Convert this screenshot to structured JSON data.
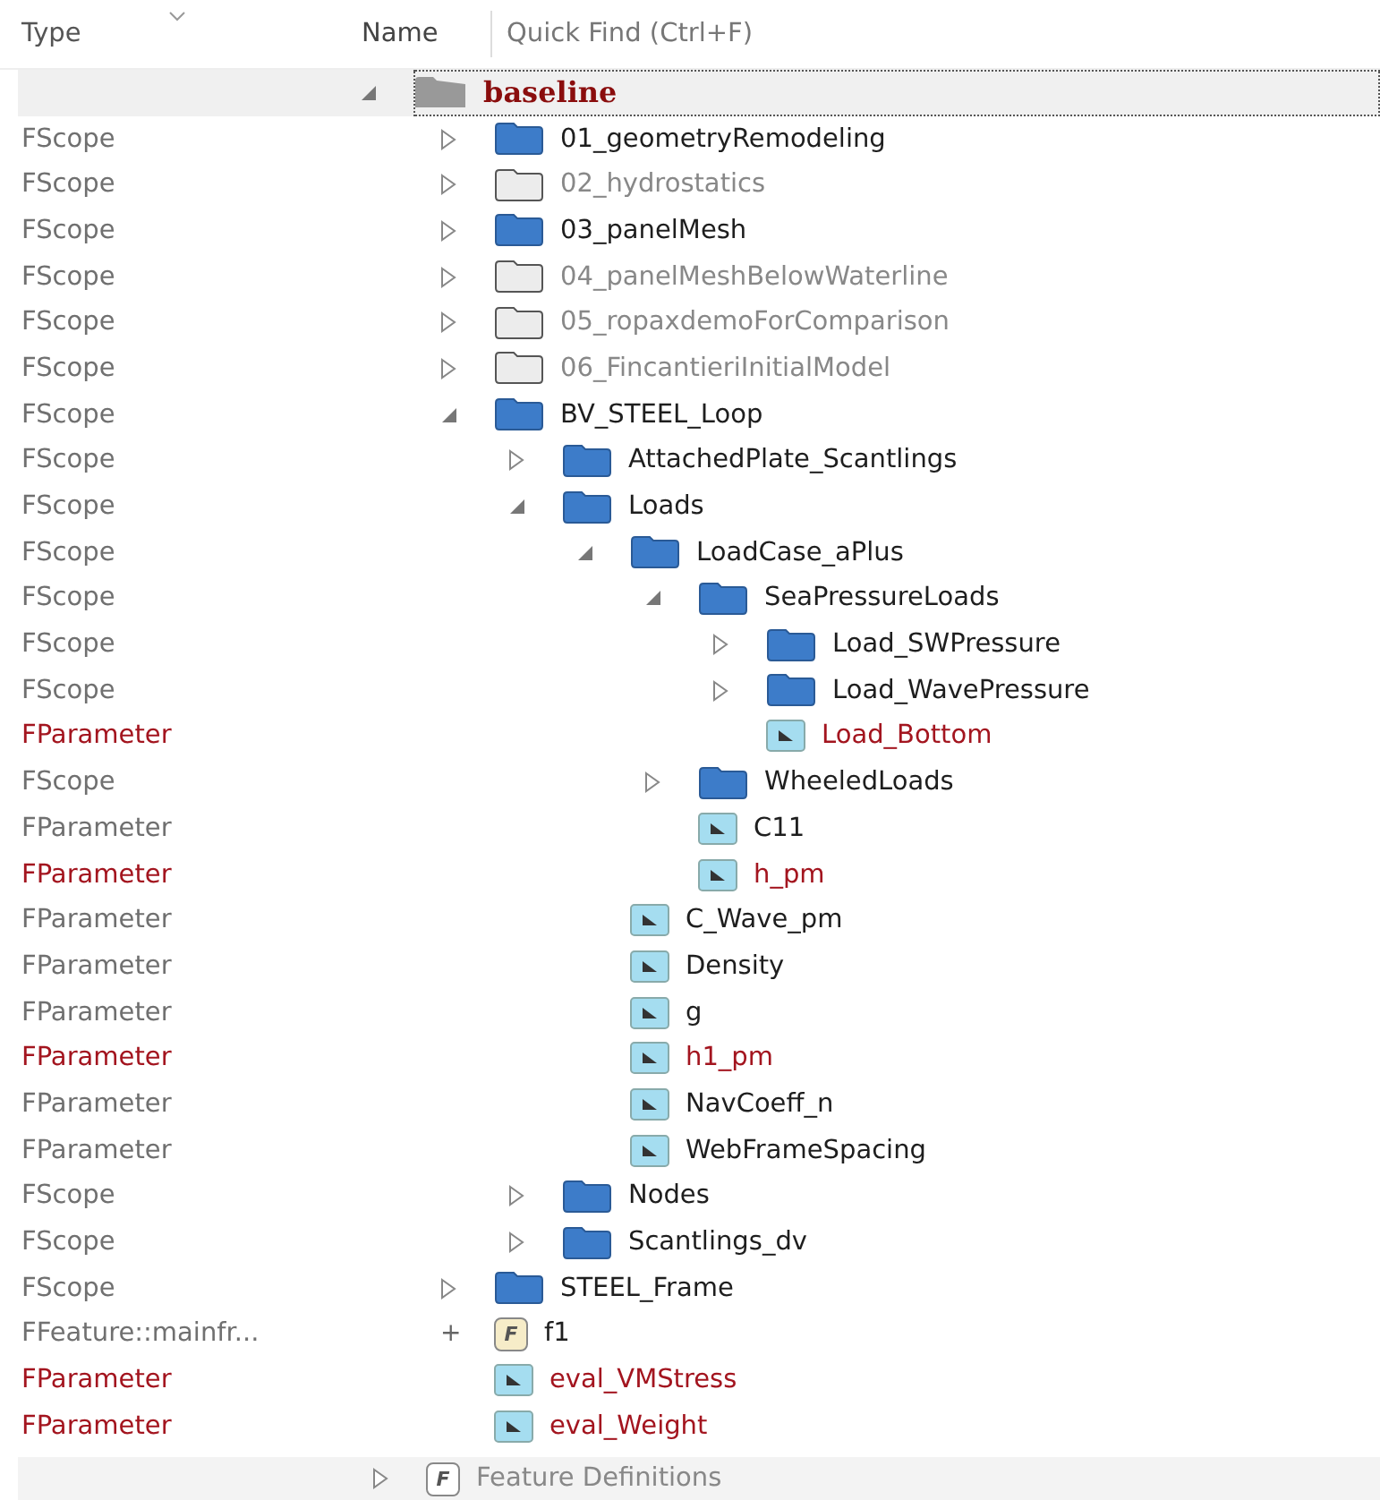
{
  "header": {
    "columns": [
      "Type",
      "Name"
    ],
    "search": {
      "placeholder": "Quick Find (Ctrl+F)"
    }
  },
  "tree": {
    "name": "baseline",
    "kind": "root",
    "selected": true,
    "expanded": true,
    "children": [
      {
        "type": "FScope",
        "name": "01_geometryRemodeling",
        "kind": "folder",
        "disabled": false,
        "modified": false,
        "expanded": false
      },
      {
        "type": "FScope",
        "name": "02_hydrostatics",
        "kind": "folder",
        "disabled": true,
        "modified": false,
        "expanded": false
      },
      {
        "type": "FScope",
        "name": "03_panelMesh",
        "kind": "folder",
        "disabled": false,
        "modified": false,
        "expanded": false
      },
      {
        "type": "FScope",
        "name": "04_panelMeshBelowWaterline",
        "kind": "folder",
        "disabled": true,
        "modified": false,
        "expanded": false
      },
      {
        "type": "FScope",
        "name": "05_ropaxdemoForComparison",
        "kind": "folder",
        "disabled": true,
        "modified": false,
        "expanded": false
      },
      {
        "type": "FScope",
        "name": "06_FincantieriInitialModel",
        "kind": "folder",
        "disabled": true,
        "modified": false,
        "expanded": false
      },
      {
        "type": "FScope",
        "name": "BV_STEEL_Loop",
        "kind": "folder",
        "disabled": false,
        "modified": false,
        "expanded": true,
        "children": [
          {
            "type": "FScope",
            "name": "AttachedPlate_Scantlings",
            "kind": "folder",
            "disabled": false,
            "modified": false,
            "expanded": false
          },
          {
            "type": "FScope",
            "name": "Loads",
            "kind": "folder",
            "disabled": false,
            "modified": false,
            "expanded": true,
            "children": [
              {
                "type": "FScope",
                "name": "LoadCase_aPlus",
                "kind": "folder",
                "disabled": false,
                "modified": false,
                "expanded": true,
                "children": [
                  {
                    "type": "FScope",
                    "name": "SeaPressureLoads",
                    "kind": "folder",
                    "disabled": false,
                    "modified": false,
                    "expanded": true,
                    "children": [
                      {
                        "type": "FScope",
                        "name": "Load_SWPressure",
                        "kind": "folder",
                        "disabled": false,
                        "modified": false,
                        "expanded": false
                      },
                      {
                        "type": "FScope",
                        "name": "Load_WavePressure",
                        "kind": "folder",
                        "disabled": false,
                        "modified": false,
                        "expanded": false
                      },
                      {
                        "type": "FParameter",
                        "name": "Load_Bottom",
                        "kind": "parameter",
                        "modified": true
                      }
                    ]
                  },
                  {
                    "type": "FScope",
                    "name": "WheeledLoads",
                    "kind": "folder",
                    "disabled": false,
                    "modified": false,
                    "expanded": false
                  },
                  {
                    "type": "FParameter",
                    "name": "C11",
                    "kind": "parameter",
                    "modified": false
                  },
                  {
                    "type": "FParameter",
                    "name": "h_pm",
                    "kind": "parameter",
                    "modified": true
                  }
                ]
              },
              {
                "type": "FParameter",
                "name": "C_Wave_pm",
                "kind": "parameter",
                "modified": false
              },
              {
                "type": "FParameter",
                "name": "Density",
                "kind": "parameter",
                "modified": false
              },
              {
                "type": "FParameter",
                "name": "g",
                "kind": "parameter",
                "modified": false
              },
              {
                "type": "FParameter",
                "name": "h1_pm",
                "kind": "parameter",
                "modified": true
              },
              {
                "type": "FParameter",
                "name": "NavCoeff_n",
                "kind": "parameter",
                "modified": false
              },
              {
                "type": "FParameter",
                "name": "WebFrameSpacing",
                "kind": "parameter",
                "modified": false
              }
            ]
          },
          {
            "type": "FScope",
            "name": "Nodes",
            "kind": "folder",
            "disabled": false,
            "modified": false,
            "expanded": false
          },
          {
            "type": "FScope",
            "name": "Scantlings_dv",
            "kind": "folder",
            "disabled": false,
            "modified": false,
            "expanded": false
          }
        ]
      },
      {
        "type": "FScope",
        "name": "STEEL_Frame",
        "kind": "folder",
        "disabled": false,
        "modified": false,
        "expanded": false
      },
      {
        "type": "FFeature::mainfr...",
        "name": "f1",
        "kind": "feature",
        "modified": false,
        "marker": "+",
        "icon_letter": "F"
      },
      {
        "type": "FParameter",
        "name": "eval_VMStress",
        "kind": "parameter",
        "modified": true
      },
      {
        "type": "FParameter",
        "name": "eval_Weight",
        "kind": "parameter",
        "modified": true
      }
    ]
  },
  "footer_row": {
    "name": "Feature Definitions",
    "icon_letter": "F",
    "expanded": false
  }
}
